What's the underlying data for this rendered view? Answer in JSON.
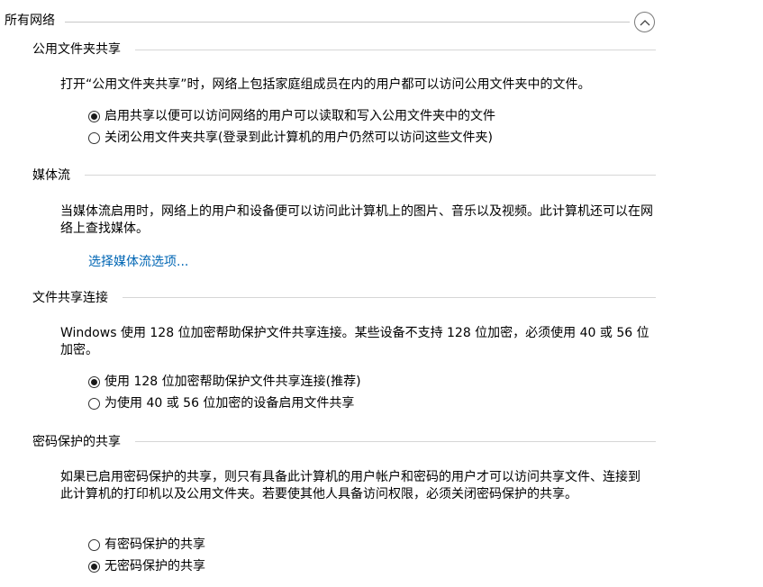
{
  "group": {
    "title": "所有网络",
    "collapse_icon": "chevron-up-icon"
  },
  "public_folder_sharing": {
    "title": "公用文件夹共享",
    "description": "打开“公用文件夹共享”时，网络上包括家庭组成员在内的用户都可以访问公用文件夹中的文件。",
    "options": [
      {
        "label": "启用共享以便可以访问网络的用户可以读取和写入公用文件夹中的文件",
        "checked": true
      },
      {
        "label": "关闭公用文件夹共享(登录到此计算机的用户仍然可以访问这些文件夹)",
        "checked": false
      }
    ]
  },
  "media_streaming": {
    "title": "媒体流",
    "description": "当媒体流启用时，网络上的用户和设备便可以访问此计算机上的图片、音乐以及视频。此计算机还可以在网络上查找媒体。",
    "link": "选择媒体流选项..."
  },
  "file_sharing_connections": {
    "title": "文件共享连接",
    "description": "Windows 使用 128 位加密帮助保护文件共享连接。某些设备不支持 128 位加密，必须使用 40 或 56 位加密。",
    "options": [
      {
        "label": "使用 128 位加密帮助保护文件共享连接(推荐)",
        "checked": true
      },
      {
        "label": "为使用 40 或 56 位加密的设备启用文件共享",
        "checked": false
      }
    ]
  },
  "password_protected_sharing": {
    "title": "密码保护的共享",
    "description": "如果已启用密码保护的共享，则只有具备此计算机的用户帐户和密码的用户才可以访问共享文件、连接到此计算机的打印机以及公用文件夹。若要使其他人具备访问权限，必须关闭密码保护的共享。",
    "options": [
      {
        "label": "有密码保护的共享",
        "checked": false
      },
      {
        "label": "无密码保护的共享",
        "checked": true
      }
    ]
  }
}
